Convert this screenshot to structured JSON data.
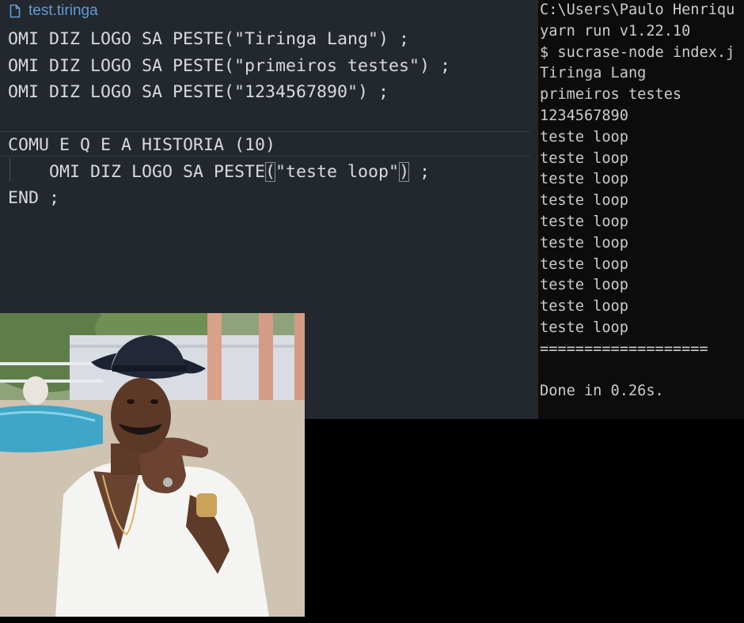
{
  "editor": {
    "tab_title": "test.tiringa",
    "code_lines": [
      "OMI DIZ LOGO SA PESTE(\"Tiringa Lang\") ;",
      "OMI DIZ LOGO SA PESTE(\"primeiros testes\") ;",
      "OMI DIZ LOGO SA PESTE(\"1234567890\") ;",
      "",
      "COMU E Q E A HISTORIA (10)",
      "END ;"
    ],
    "active_line": {
      "indent": "    ",
      "before": "OMI DIZ LOGO SA PESTE",
      "open_paren": "(",
      "string": "\"teste loop\"",
      "close_paren": ")",
      "after": " ;"
    }
  },
  "terminal": {
    "lines": [
      "C:\\Users\\Paulo Henriqu",
      "yarn run v1.22.10",
      "$ sucrase-node index.j",
      "Tiringa Lang",
      "primeiros testes",
      "1234567890",
      "teste loop",
      "teste loop",
      "teste loop",
      "teste loop",
      "teste loop",
      "teste loop",
      "teste loop",
      "teste loop",
      "teste loop",
      "teste loop",
      "===================",
      "Done in 0.26s."
    ]
  },
  "colors": {
    "editor_bg": "#23272e",
    "editor_text": "#d7dae0",
    "tab_accent": "#5f9ed6",
    "terminal_bg": "#0c0c0c",
    "terminal_text": "#cccccc"
  },
  "icons": {
    "tab_file_icon": "file-icon"
  }
}
